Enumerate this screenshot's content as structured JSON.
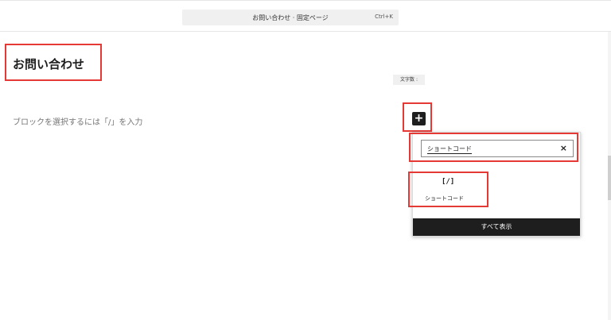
{
  "header": {
    "command_title": "お問い合わせ · 固定ページ",
    "shortcut": "Ctrl+K"
  },
  "editor": {
    "page_title": "お問い合わせ",
    "word_count_label": "文字数 :",
    "block_placeholder": "ブロックを選択するには「/」を入力",
    "add_block_icon": "+"
  },
  "inserter": {
    "search_value": "ショートコード",
    "clear_icon": "×",
    "result_icon": "[/]",
    "result_label": "ショートコード",
    "show_all_label": "すべて表示"
  },
  "colors": {
    "annotation": "#e53935",
    "dark": "#1e1e1e"
  }
}
